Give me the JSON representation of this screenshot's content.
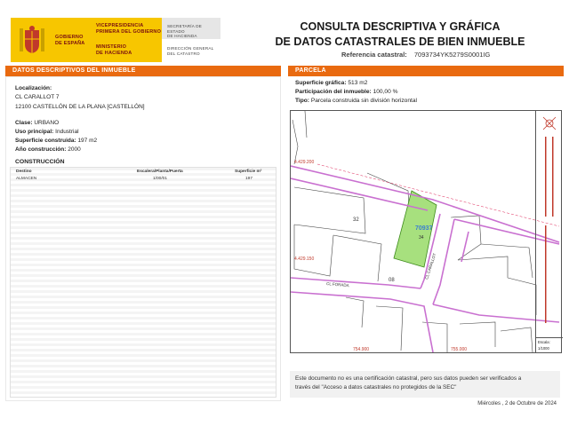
{
  "header": {
    "gov_line1": "GOBIERNO",
    "gov_line2": "DE ESPAÑA",
    "vp_line1": "VICEPRESIDENCIA",
    "vp_line2": "PRIMERA DEL GOBIERNO",
    "min_line1": "MINISTERIO",
    "min_line2": "DE HACIENDA",
    "sec_line1": "SECRETARÍA DE ESTADO",
    "sec_line2": "DE HACIENDA",
    "dir_line1": "DIRECCIÓN GENERAL",
    "dir_line2": "DEL CATASTRO",
    "title_line1": "CONSULTA DESCRIPTIVA Y GRÁFICA",
    "title_line2": "DE DATOS CATASTRALES DE BIEN INMUEBLE",
    "ref_label": "Referencia catastral:",
    "ref_value": "7093734YK5279S0001IG"
  },
  "left": {
    "section_title": "DATOS DESCRIPTIVOS DEL INMUEBLE",
    "loc_label": "Localización:",
    "loc_line1": "CL CARALLOT 7",
    "loc_line2": "12100 CASTELLÓN DE LA PLANA [CASTELLÓN]",
    "clase_label": "Clase:",
    "clase_value": "URBANO",
    "uso_label": "Uso principal:",
    "uso_value": "Industrial",
    "sup_label": "Superficie construida:",
    "sup_value": "197 m2",
    "anio_label": "Año construcción:",
    "anio_value": "2000",
    "constr_title": "CONSTRUCCIÓN",
    "table": {
      "headers": [
        "Destino",
        "Escalera/Planta/Puerta",
        "Superficie m²"
      ],
      "rows": [
        [
          "ALMACEN",
          "1/00/01",
          "197"
        ]
      ]
    }
  },
  "right": {
    "section_title": "PARCELA",
    "sup_label": "Superficie gráfica:",
    "sup_value": "513 m2",
    "part_label": "Participación del inmueble:",
    "part_value": "100,00 %",
    "tipo_label": "Tipo:",
    "tipo_value": "Parcela construida sin división horizontal",
    "map": {
      "coord_a": "4.429.200",
      "coord_b": "4.429.150",
      "coord_c": "754.900",
      "coord_d": "755.000",
      "parcel_id": "70937",
      "parcel_no": "34",
      "block_32": "32",
      "block_08": "08",
      "street_1": "CL CARALLOT",
      "street_2": "CL FORADA",
      "scale_label": "Escala:",
      "scale_value": "1/1000",
      "parcel_color": "#a7e07e",
      "line_color": "#c970d0"
    }
  },
  "footer": {
    "note_line1": "Este documento no es una certificación catastral, pero sus datos pueden ser verificados a",
    "note_line2": "través del \"Acceso a datos catastrales no protegidos de la SEC\"",
    "date": "Miércoles , 2 de Octubre de 2024"
  }
}
